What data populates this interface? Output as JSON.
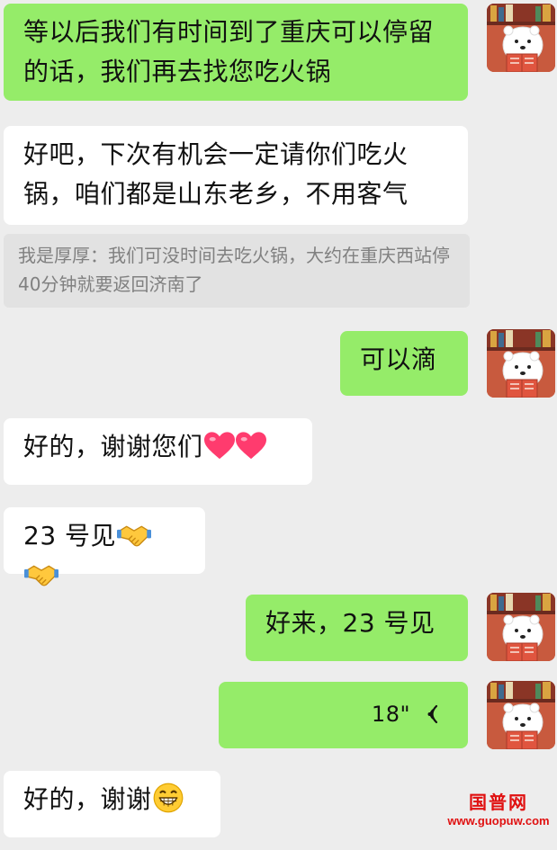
{
  "messages": [
    {
      "side": "sent",
      "type": "text",
      "text": "等以后我们有时间到了重庆可以停留的话，我们再去找您吃火锅"
    },
    {
      "side": "received",
      "type": "text",
      "text": "好吧，下次有机会一定请你们吃火锅，咱们都是山东老乡，不用客气"
    },
    {
      "side": "quote",
      "type": "quote",
      "text": "我是厚厚：我们可没时间去吃火锅，大约在重庆西站停40分钟就要返回济南了"
    },
    {
      "side": "sent",
      "type": "text",
      "text": "可以滴"
    },
    {
      "side": "received",
      "type": "text",
      "text": "好的，谢谢您们",
      "emoji": [
        "red-heart-icon",
        "red-heart-icon"
      ]
    },
    {
      "side": "received",
      "type": "text",
      "text": "23 号见",
      "emoji": [
        "handshake-icon",
        "handshake-icon"
      ]
    },
    {
      "side": "sent",
      "type": "text",
      "text": "好来，23 号见"
    },
    {
      "side": "sent",
      "type": "voice",
      "duration": "18\""
    },
    {
      "side": "received",
      "type": "text",
      "text": "好的，谢谢",
      "emoji": [
        "grinning-face-icon"
      ]
    }
  ],
  "avatar": {
    "icon": "polar-bear-reading-book-icon"
  },
  "watermark": {
    "title": "国普网",
    "url": "www.guopuw.com"
  },
  "colors": {
    "background": "#ededed",
    "sent_bubble": "#95ec69",
    "received_bubble": "#ffffff",
    "quote_background": "#e2e2e2",
    "watermark": "#e01111"
  }
}
